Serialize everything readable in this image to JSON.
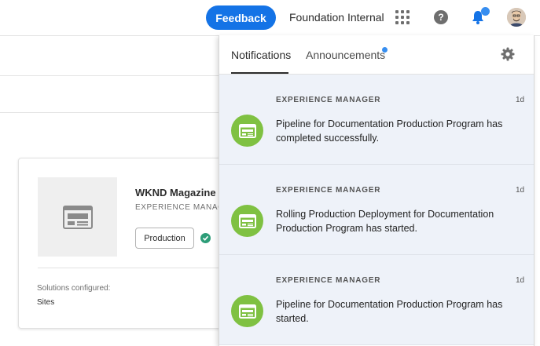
{
  "header": {
    "feedback_label": "Feedback",
    "org_name": "Foundation Internal",
    "apps_icon": "apps-grid-icon",
    "help_icon": "help-icon",
    "help_glyph": "?",
    "bell_icon": "bell-icon",
    "avatar_icon": "user-avatar",
    "accent": "#1473e6"
  },
  "card": {
    "title": "WKND Magazine",
    "subtitle": "EXPERIENCE MANAG",
    "environment_tag": "Production",
    "status_color": "#2d9d78",
    "solutions_label": "Solutions configured:",
    "solutions_value": "Sites"
  },
  "panel": {
    "tabs": [
      {
        "label": "Notifications",
        "selected": true
      },
      {
        "label": "Announcements",
        "selected": false,
        "has_unread": true
      }
    ],
    "settings_icon": "gear-icon",
    "notifications": [
      {
        "source": "EXPERIENCE MANAGER",
        "time": "1d",
        "text": "Pipeline for Documentation Production Program has completed successfully.",
        "icon": "experience-manager-icon"
      },
      {
        "source": "EXPERIENCE MANAGER",
        "time": "1d",
        "text": "Rolling Production Deployment for Documentation Production Program has started.",
        "icon": "experience-manager-icon"
      },
      {
        "source": "EXPERIENCE MANAGER",
        "time": "1d",
        "text": "Pipeline for Documentation Production Program has started.",
        "icon": "experience-manager-icon"
      }
    ],
    "item_background": "#eef2f9",
    "icon_color": "#7fc142"
  }
}
